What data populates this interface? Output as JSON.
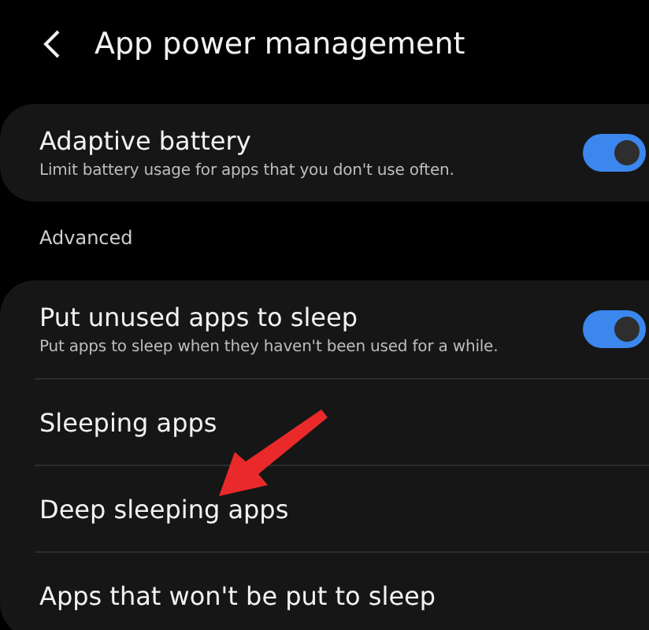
{
  "header": {
    "title": "App power management"
  },
  "sections": [
    {
      "items": [
        {
          "kind": "toggle",
          "title": "Adaptive battery",
          "subtitle": "Limit battery usage for apps that you don't use often.",
          "on": true
        }
      ]
    },
    {
      "heading": "Advanced",
      "items": [
        {
          "kind": "toggle",
          "title": "Put unused apps to sleep",
          "subtitle": "Put apps to sleep when they haven't been used for a while.",
          "on": true
        },
        {
          "kind": "link",
          "title": "Sleeping apps"
        },
        {
          "kind": "link",
          "title": "Deep sleeping apps"
        },
        {
          "kind": "link",
          "title": "Apps that won't be put to sleep"
        }
      ]
    }
  ]
}
